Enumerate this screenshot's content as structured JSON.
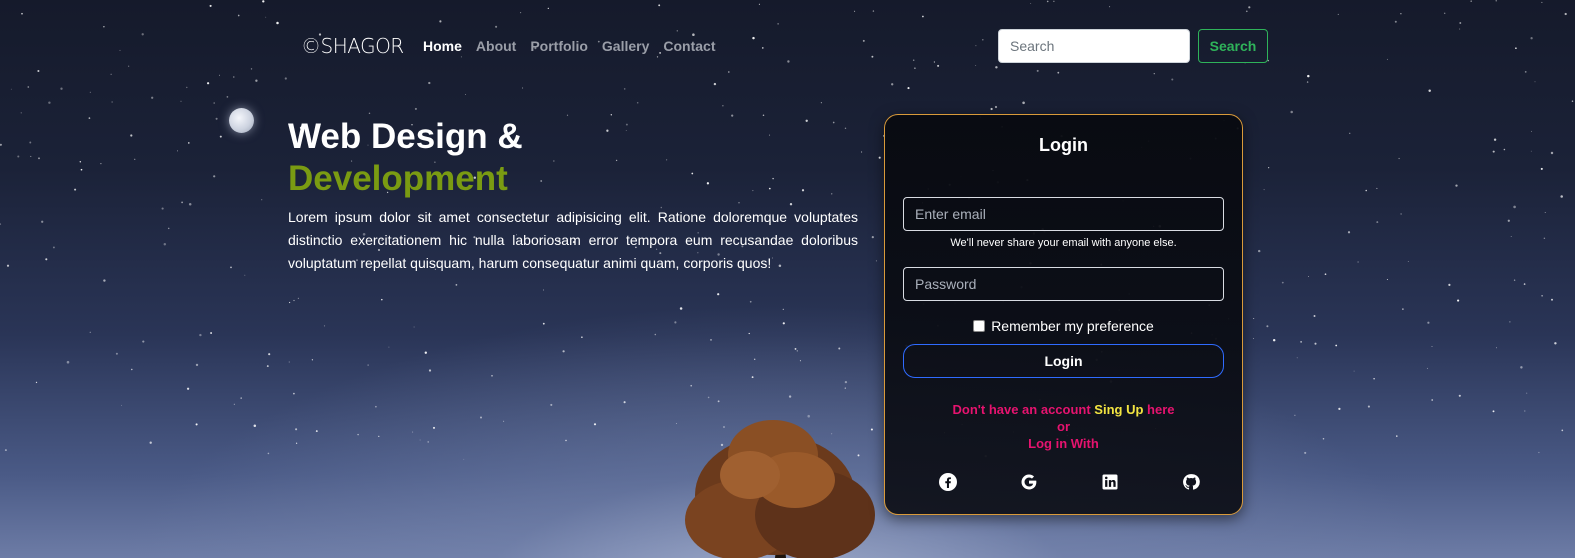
{
  "navbar": {
    "brand": "©SHAGOR",
    "links": [
      {
        "label": "Home",
        "active": true
      },
      {
        "label": "About",
        "active": false
      },
      {
        "label": "Portfolio",
        "active": false
      },
      {
        "label": "Gallery",
        "active": false
      },
      {
        "label": "Contact",
        "active": false
      }
    ],
    "search": {
      "placeholder": "Search",
      "value": ""
    },
    "search_button": "Search"
  },
  "hero": {
    "title_line1": "Web Design &",
    "title_line2": "Development",
    "paragraph": "Lorem ipsum dolor sit amet consectetur adipisicing elit. Ratione doloremque voluptates distinctio exercitationem hic nulla laboriosam error tempora eum recusandae doloribus voluptatum repellat quisquam, harum consequatur animi quam, corporis quos!"
  },
  "login": {
    "title": "Login",
    "email_placeholder": "Enter email",
    "email_help": "We'll never share your email with anyone else.",
    "password_placeholder": "Password",
    "remember_label": "Remember my preference",
    "remember_checked": false,
    "submit_label": "Login",
    "signup_prefix": "Don't have an account ",
    "signup_link": "Sing Up",
    "signup_suffix": " here",
    "or_text": "or",
    "login_with": "Log in With",
    "socials": [
      "facebook-icon",
      "google-icon",
      "linkedin-icon",
      "github-icon"
    ]
  },
  "colors": {
    "accent_green": "#7a9b12",
    "search_button": "#2fb35a",
    "card_border": "#d99a3a",
    "login_button_border": "#2f6bff",
    "signup_text": "#e6136f",
    "signup_link": "#f3e541"
  }
}
